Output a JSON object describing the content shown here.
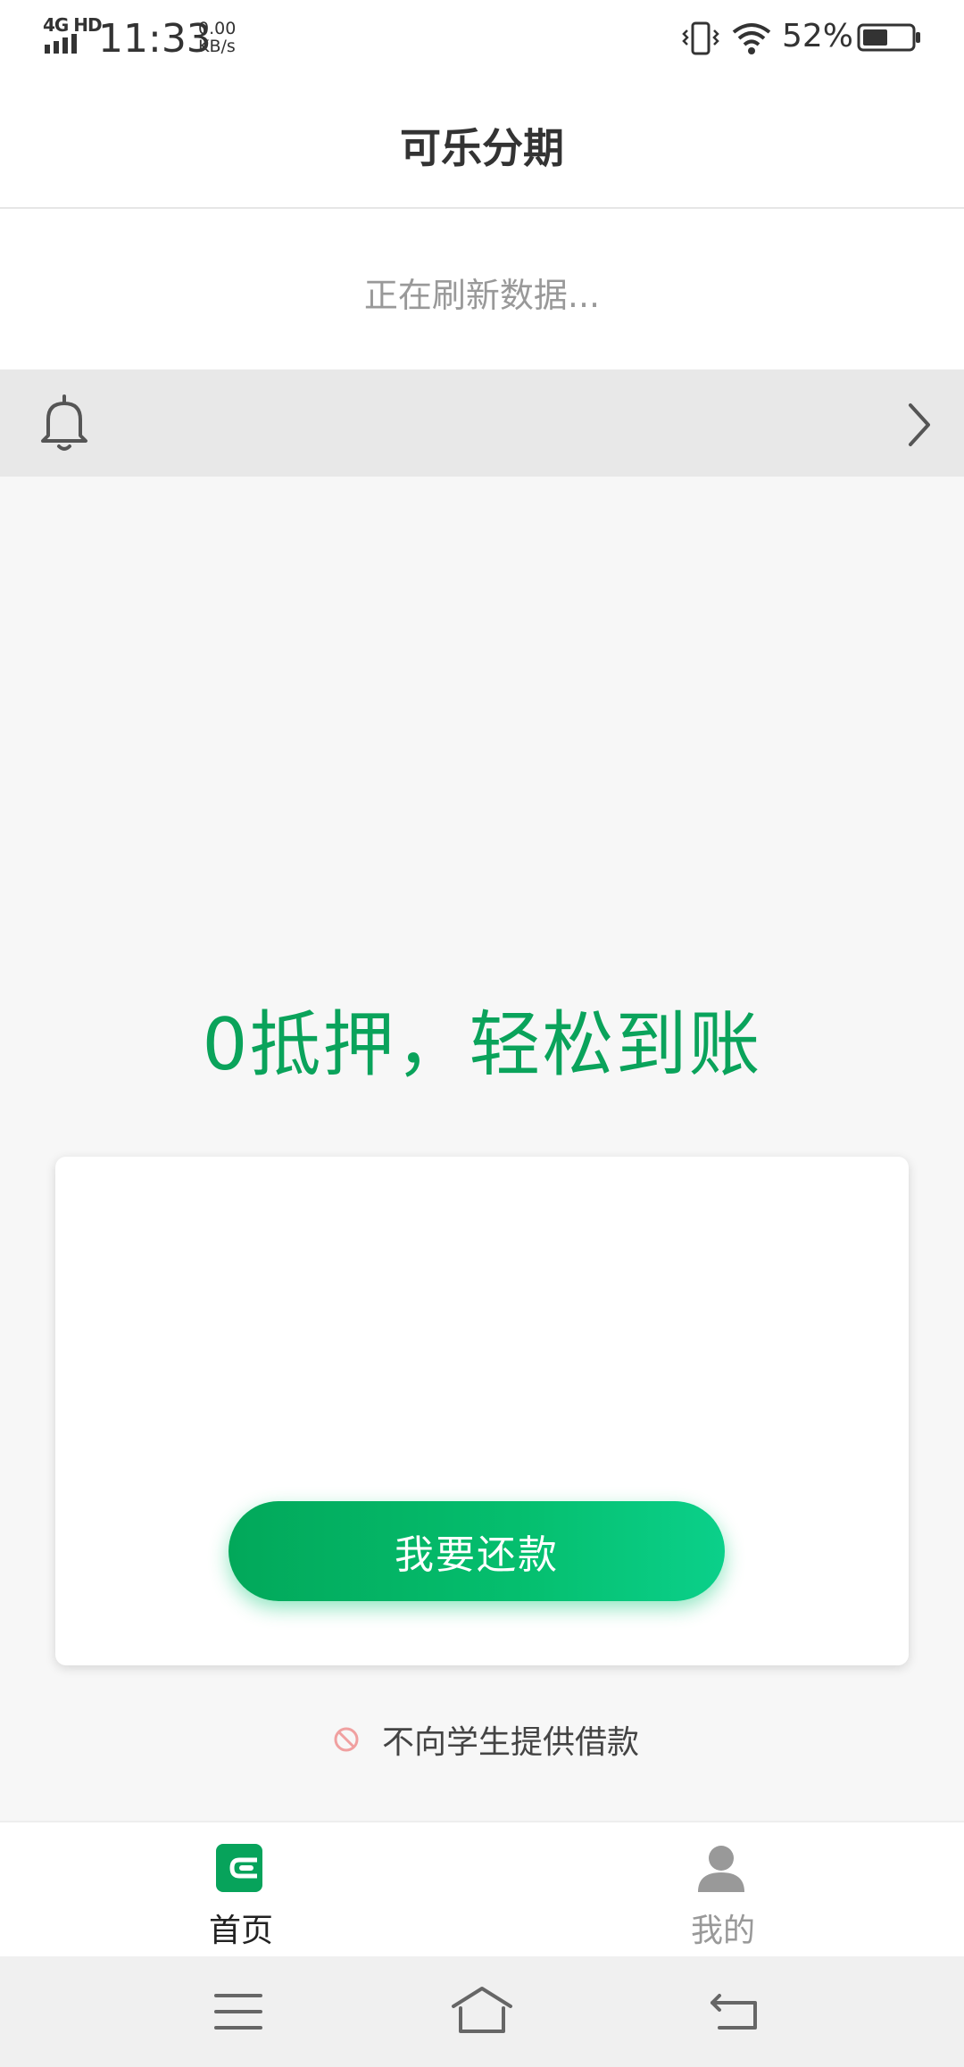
{
  "status_bar": {
    "network": "4G HD",
    "time": "11:33",
    "speed_value": "0.00",
    "speed_unit": "KB/s",
    "battery_percent": "52%",
    "battery_level": 0.52
  },
  "header": {
    "title": "可乐分期"
  },
  "refresh": {
    "text": "正在刷新数据..."
  },
  "notice_bar": {
    "icon": "bell-icon",
    "action_icon": "chevron-right-icon"
  },
  "main": {
    "slogan": "0抵押，轻松到账",
    "repay_button_label": "我要还款",
    "student_notice": "不向学生提供借款"
  },
  "tabs": [
    {
      "label": "首页",
      "icon": "wallet-icon",
      "active": true
    },
    {
      "label": "我的",
      "icon": "person-icon",
      "active": false
    }
  ],
  "colors": {
    "brand_green": "#0aa35b",
    "active_tab_icon": "#07a35b",
    "inactive_tab": "#999999"
  }
}
